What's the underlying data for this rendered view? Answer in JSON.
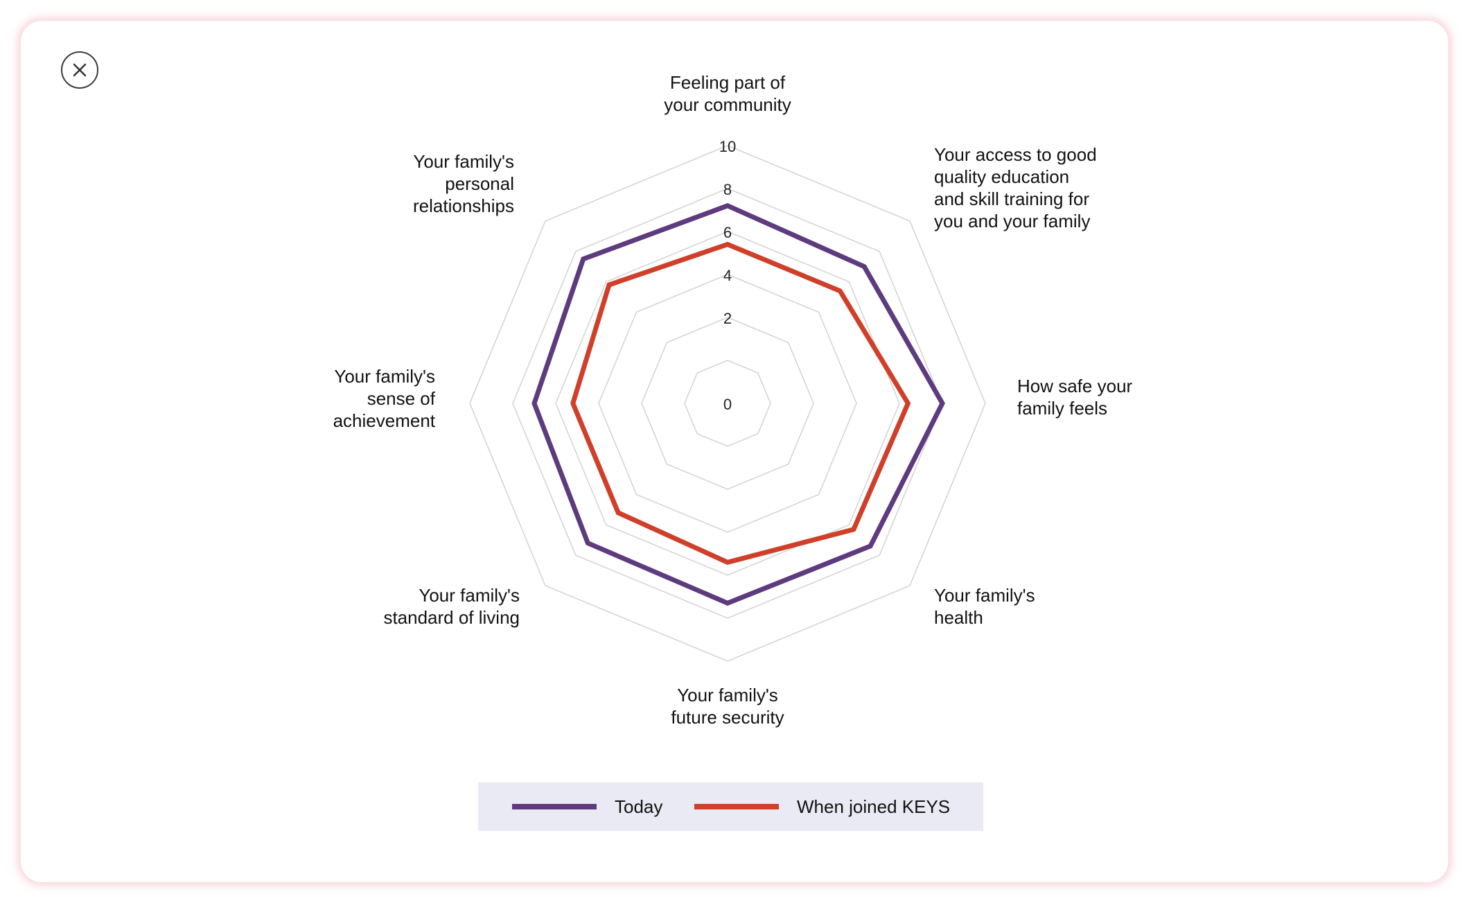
{
  "close_button": {
    "icon": "close-icon"
  },
  "chart_data": {
    "type": "radar",
    "axes": [
      [
        "Feeling part of",
        "your community"
      ],
      [
        "Your access to good",
        "quality education",
        "and skill training for",
        "you and your family"
      ],
      [
        "How safe your",
        "family feels"
      ],
      [
        "Your family's",
        "health"
      ],
      [
        "Your family's",
        "future security"
      ],
      [
        "Your family's",
        "standard of living"
      ],
      [
        "Your family's",
        "sense of",
        "achievement"
      ],
      [
        "Your family's",
        "personal",
        "relationships"
      ]
    ],
    "rlim": [
      0,
      10
    ],
    "rticks": [
      "0",
      "2",
      "4",
      "6",
      "8",
      "10"
    ],
    "grid": true,
    "series": [
      {
        "name": "Today",
        "color": "#5e3a7e",
        "values": [
          7.2,
          7.0,
          8.0,
          7.4,
          7.3,
          7.2,
          7.0,
          7.5
        ]
      },
      {
        "name": "When joined KEYS",
        "color": "#cf3f29",
        "values": [
          5.4,
          5.4,
          6.4,
          6.3,
          5.4,
          5.2,
          5.2,
          5.8
        ]
      }
    ],
    "legend": "bottom-center"
  },
  "legend": {
    "today_label": "Today",
    "joined_label": "When joined KEYS",
    "today_color": "#5e3a7e",
    "joined_color": "#cf3f29"
  }
}
